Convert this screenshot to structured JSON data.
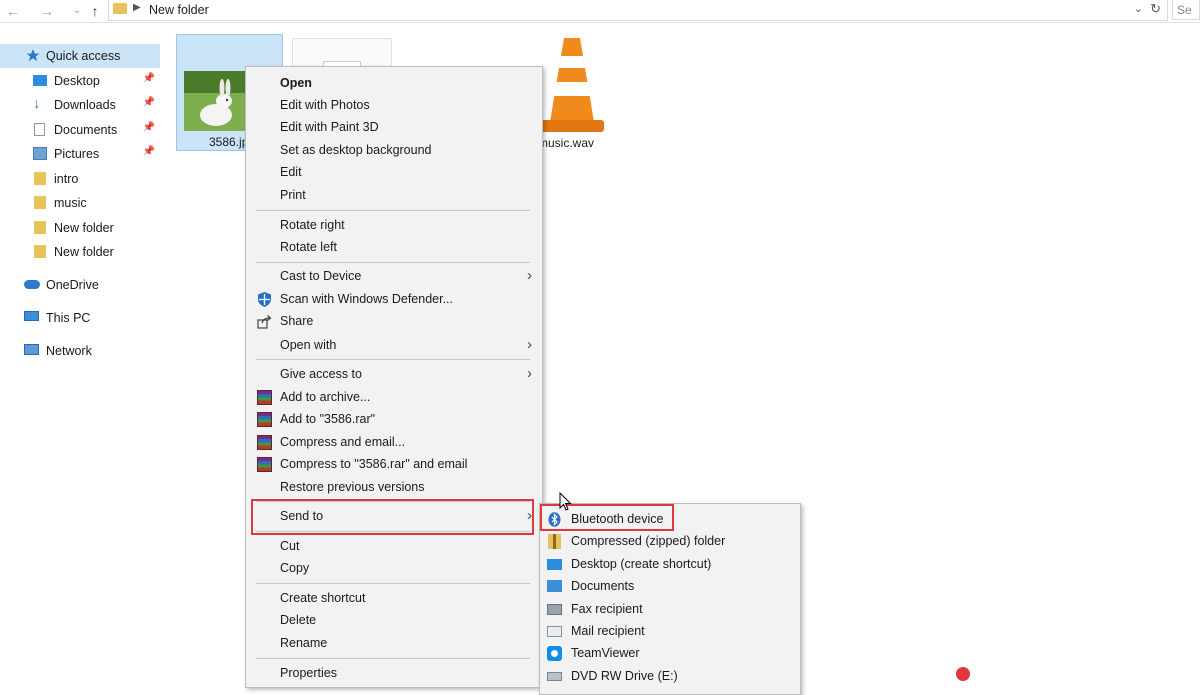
{
  "address_bar": {
    "crumb": "New folder",
    "search_placeholder": "Se"
  },
  "sidebar": {
    "items": [
      {
        "label": "Quick access"
      },
      {
        "label": "Desktop"
      },
      {
        "label": "Downloads"
      },
      {
        "label": "Documents"
      },
      {
        "label": "Pictures"
      },
      {
        "label": "intro"
      },
      {
        "label": "music"
      },
      {
        "label": "New folder"
      },
      {
        "label": "New folder"
      },
      {
        "label": "OneDrive"
      },
      {
        "label": "This PC"
      },
      {
        "label": "Network"
      }
    ]
  },
  "files": [
    {
      "name": "3586.jp"
    },
    {
      "name": "music.wav"
    }
  ],
  "context_menu": {
    "items": [
      {
        "label": "Open"
      },
      {
        "label": "Edit with Photos"
      },
      {
        "label": "Edit with Paint 3D"
      },
      {
        "label": "Set as desktop background"
      },
      {
        "label": "Edit"
      },
      {
        "label": "Print"
      },
      {
        "label": "Rotate right"
      },
      {
        "label": "Rotate left"
      },
      {
        "label": "Cast to Device"
      },
      {
        "label": "Scan with Windows Defender..."
      },
      {
        "label": "Share"
      },
      {
        "label": "Open with"
      },
      {
        "label": "Give access to"
      },
      {
        "label": "Add to archive..."
      },
      {
        "label": "Add to \"3586.rar\""
      },
      {
        "label": "Compress and email..."
      },
      {
        "label": "Compress to \"3586.rar\" and email"
      },
      {
        "label": "Restore previous versions"
      },
      {
        "label": "Send to"
      },
      {
        "label": "Cut"
      },
      {
        "label": "Copy"
      },
      {
        "label": "Create shortcut"
      },
      {
        "label": "Delete"
      },
      {
        "label": "Rename"
      },
      {
        "label": "Properties"
      }
    ]
  },
  "send_to_menu": {
    "items": [
      {
        "label": "Bluetooth device"
      },
      {
        "label": "Compressed (zipped) folder"
      },
      {
        "label": "Desktop (create shortcut)"
      },
      {
        "label": "Documents"
      },
      {
        "label": "Fax recipient"
      },
      {
        "label": "Mail recipient"
      },
      {
        "label": "TeamViewer"
      },
      {
        "label": "DVD RW Drive (E:)"
      }
    ]
  },
  "colors": {
    "highlight": "#e0383e",
    "selection": "#cce4f7",
    "menu_bg": "#f2f2f2"
  }
}
